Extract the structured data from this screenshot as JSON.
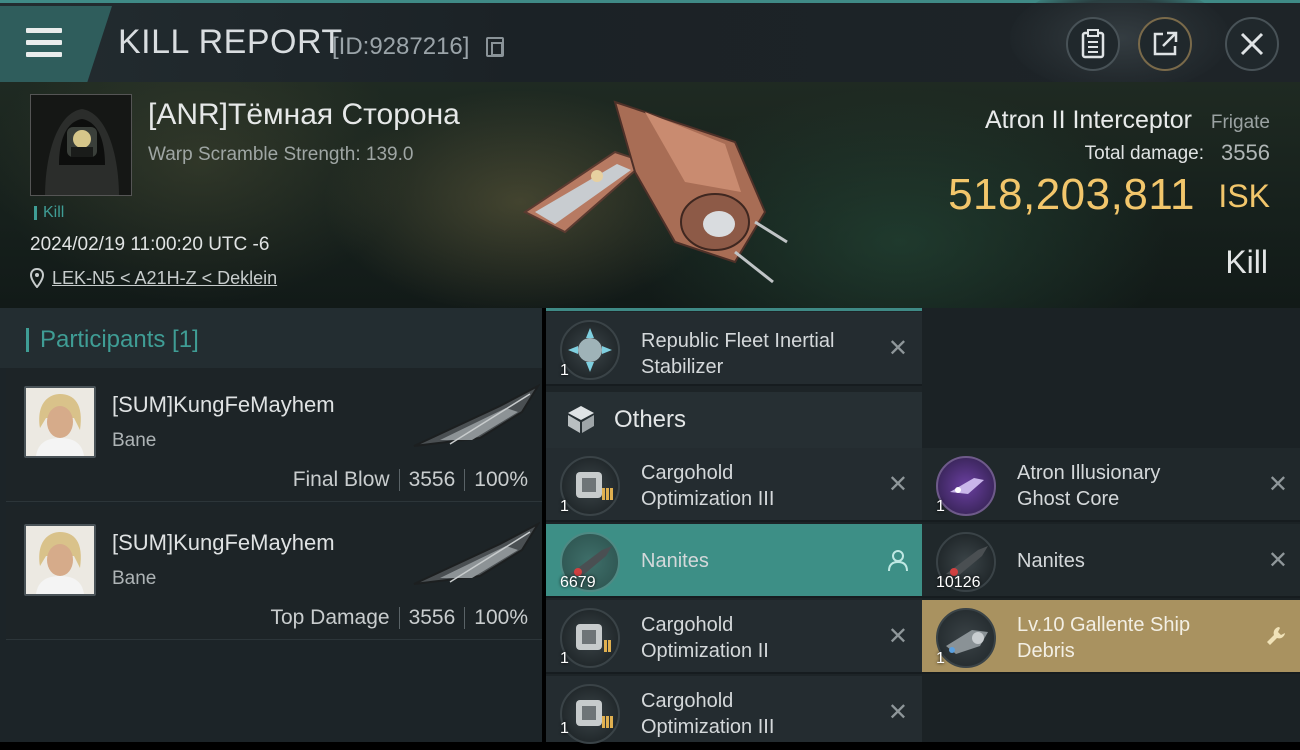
{
  "header": {
    "title": "KILL REPORT",
    "report_id": "[ID:9287216]",
    "buttons": [
      "clipboard-icon",
      "export-icon",
      "close-icon"
    ]
  },
  "victim": {
    "name": "[ANR]Тёмная Сторона",
    "warp": "Warp Scramble Strength: 139.0",
    "tag": "Kill",
    "time": "2024/02/19 11:00:20 UTC -6",
    "location": "LEK-N5 < A21H-Z < Deklein"
  },
  "ship": {
    "name": "Atron II Interceptor",
    "class": "Frigate",
    "damage_label": "Total damage:",
    "damage_value": "3556",
    "isk_value": "518,203,811",
    "isk_unit": "ISK",
    "result": "Kill"
  },
  "participants": {
    "label": "Participants [1]",
    "rows": [
      {
        "name": "[SUM]KungFeMayhem",
        "ship": "Bane",
        "role": "Final Blow",
        "damage": "3556",
        "percent": "100%"
      },
      {
        "name": "[SUM]KungFeMayhem",
        "ship": "Bane",
        "role": "Top Damage",
        "damage": "3556",
        "percent": "100%"
      }
    ]
  },
  "items": {
    "top": {
      "name_line1": "Republic Fleet Inertial",
      "name_line2": "Stabilizer",
      "qty": "1"
    },
    "others_label": "Others",
    "left": [
      {
        "name_line1": "Cargohold",
        "name_line2": "Optimization III",
        "qty": "1",
        "state": "destroyed"
      },
      {
        "name_line1": "Nanites",
        "name_line2": "",
        "qty": "6679",
        "state": "dropped"
      },
      {
        "name_line1": "Cargohold",
        "name_line2": "Optimization II",
        "qty": "1",
        "state": "destroyed"
      },
      {
        "name_line1": "Cargohold",
        "name_line2": "Optimization III",
        "qty": "1",
        "state": "destroyed"
      }
    ],
    "right": [
      {
        "name_line1": "Atron Illusionary",
        "name_line2": "Ghost Core",
        "qty": "1",
        "state": "destroyed"
      },
      {
        "name_line1": "Nanites",
        "name_line2": "",
        "qty": "10126",
        "state": "destroyed"
      },
      {
        "name_line1": "Lv.10 Gallente Ship",
        "name_line2": "Debris",
        "qty": "1",
        "state": "salvage"
      }
    ]
  },
  "colors": {
    "accent_teal": "#3f9d95",
    "isk_gold": "#f2c66b",
    "highlight_row": "#3d8f86",
    "gold_row": "#a99260"
  }
}
